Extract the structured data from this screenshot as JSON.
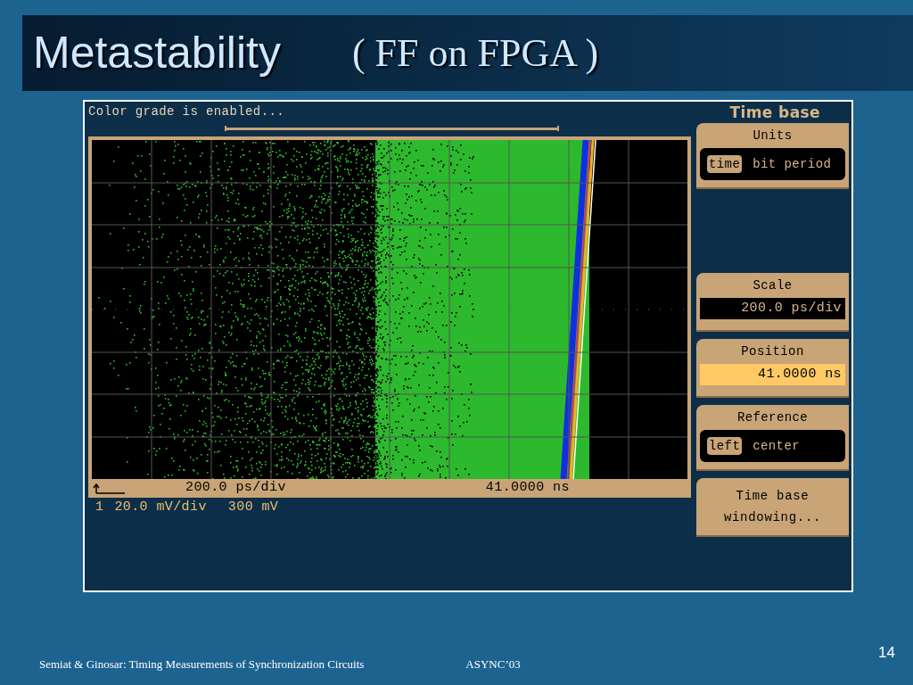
{
  "slide": {
    "title": "Metastability",
    "subtitle": "( FF on FPGA )",
    "footer": "Semiat & Ginosar: Timing Measurements of Synchronization Circuits",
    "conference": "ASYNC’03",
    "page_number": "14"
  },
  "scope": {
    "message": "Color grade is enabled...",
    "waveform_footer": {
      "scale": "200.0 ps/div",
      "position": "41.0000 ns"
    },
    "channel": {
      "number": "1",
      "scale": "20.0 mV/div",
      "offset": "300 mV"
    },
    "panel": {
      "title": "Time base",
      "groups": [
        {
          "kind": "options",
          "label": "Units",
          "options": [
            {
              "label": "time",
              "selected": true
            },
            {
              "label": "bit period",
              "selected": false
            }
          ]
        },
        {
          "kind": "value",
          "label": "Scale",
          "value": "200.0 ps/div",
          "active": false
        },
        {
          "kind": "value",
          "label": "Position",
          "value": "41.0000 ns",
          "active": true
        },
        {
          "kind": "options",
          "label": "Reference",
          "options": [
            {
              "label": "left",
              "selected": true
            },
            {
              "label": "center",
              "selected": false
            }
          ]
        },
        {
          "kind": "button",
          "label": "Time base windowing..."
        }
      ]
    }
  }
}
